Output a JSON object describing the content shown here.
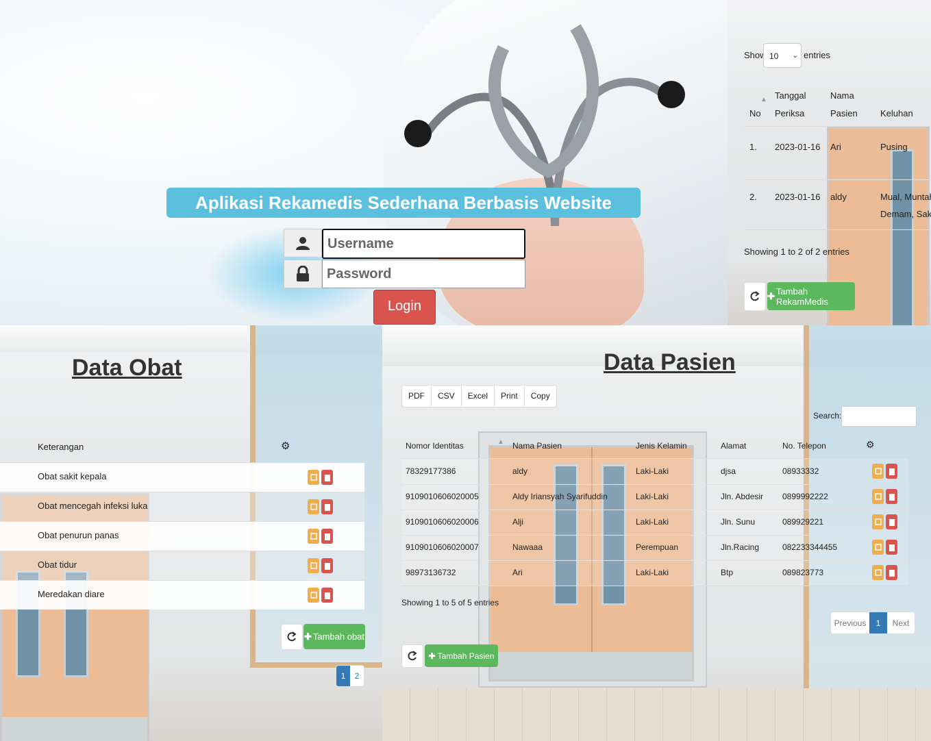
{
  "login": {
    "app_title": "Aplikasi Rekamedis Sederhana Berbasis Website",
    "username_placeholder": "Username",
    "password_placeholder": "Password",
    "login_label": "Login"
  },
  "rekam_medis": {
    "show_label": "Show",
    "entries_value": "10",
    "entries_label": "entries",
    "columns": {
      "no": "No",
      "tanggal_1": "Tanggal",
      "tanggal_2": "Periksa",
      "nama_1": "Nama",
      "nama_2": "Pasien",
      "keluhan": "Keluhan"
    },
    "rows": [
      {
        "no": "1.",
        "tanggal": "2023-01-16",
        "nama": "Ari",
        "keluhan_1": "Pusing",
        "keluhan_2": ""
      },
      {
        "no": "2.",
        "tanggal": "2023-01-16",
        "nama": "aldy",
        "keluhan_1": "Mual, Muntah, N",
        "keluhan_2": "Demam, Sakit p"
      }
    ],
    "info": "Showing 1 to 2 of 2 entries",
    "add_label": "Tambah RekamMedis"
  },
  "obat": {
    "heading": "Data Obat",
    "columns": {
      "keterangan": "Keterangan"
    },
    "rows": [
      {
        "keterangan": "Obat sakit kepala"
      },
      {
        "keterangan": "Obat mencegah infeksi luka"
      },
      {
        "keterangan": "Obat penurun panas"
      },
      {
        "keterangan": "Obat tidur"
      },
      {
        "keterangan": "Meredakan diare"
      }
    ],
    "add_label": "Tambah obat",
    "pages": [
      "1",
      "2"
    ]
  },
  "pasien": {
    "heading": "Data Pasien",
    "export_buttons": [
      "PDF",
      "CSV",
      "Excel",
      "Print",
      "Copy"
    ],
    "search_label": "Search:",
    "columns": {
      "nomor": "Nomor Identitas",
      "nama": "Nama Pasien",
      "jenis": "Jenis Kelamin",
      "alamat": "Alamat",
      "telepon": "No. Telepon"
    },
    "rows": [
      {
        "nomor": "78329177386",
        "nama": "aldy",
        "jenis": "Laki-Laki",
        "alamat": "djsa",
        "telepon": "08933332"
      },
      {
        "nomor": "9109010606020005",
        "nama": "Aldy Iriansyah Syarifuddin",
        "jenis": "Laki-Laki",
        "alamat": "Jln. Abdesir",
        "telepon": "0899992222"
      },
      {
        "nomor": "9109010606020006",
        "nama": "Alji",
        "jenis": "Laki-Laki",
        "alamat": "Jln. Sunu",
        "telepon": "089929221"
      },
      {
        "nomor": "9109010606020007",
        "nama": "Nawaaa",
        "jenis": "Perempuan",
        "alamat": "Jln.Racing",
        "telepon": "082233344455"
      },
      {
        "nomor": "98973136732",
        "nama": "Ari",
        "jenis": "Laki-Laki",
        "alamat": "Btp",
        "telepon": "089823773"
      }
    ],
    "info": "Showing 1 to 5 of 5 entries",
    "pagination": {
      "prev": "Previous",
      "current": "1",
      "next": "Next"
    },
    "add_label": "Tambah Pasien"
  },
  "icons": [
    "user-icon",
    "lock-icon",
    "refresh-icon",
    "plus-icon",
    "gear-icon",
    "edit-icon",
    "trash-icon",
    "sort-icon"
  ],
  "colors": {
    "info": "#5bc0de",
    "danger": "#d9534f",
    "success": "#5cb85c",
    "warning": "#f0ad4e",
    "primary": "#337ab7"
  }
}
